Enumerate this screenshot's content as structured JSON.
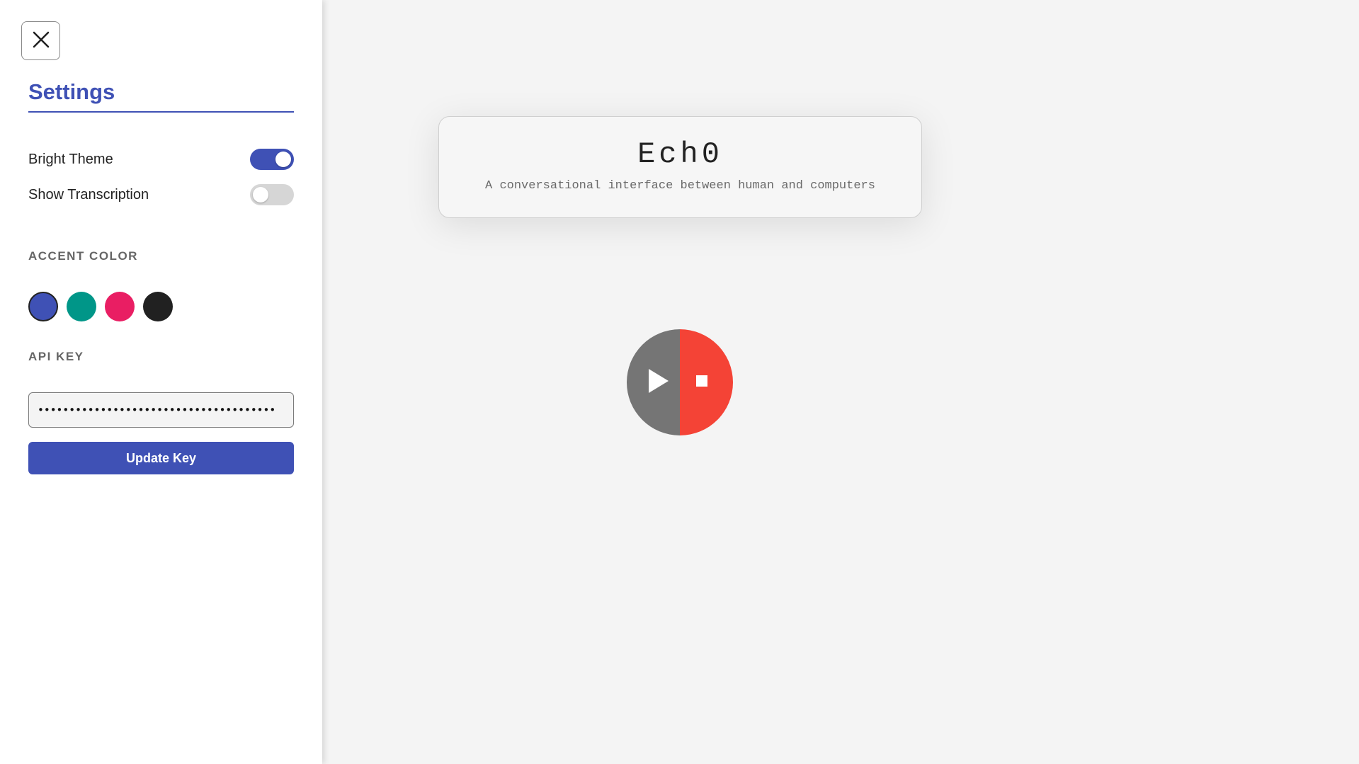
{
  "sidebar": {
    "close_icon": "close-icon",
    "title": "Settings",
    "toggles": [
      {
        "label": "Bright Theme",
        "on": true
      },
      {
        "label": "Show Transcription",
        "on": false
      }
    ],
    "accent_section_label": "ACCENT COLOR",
    "accent_colors": [
      "#3f51b5",
      "#009688",
      "#e91e63",
      "#212121"
    ],
    "selected_accent": "#3f51b5",
    "api_key_label": "API KEY",
    "api_key_value": "••••••••••••••••••••••••••••••••••••••",
    "update_button_label": "Update Key"
  },
  "main": {
    "app_title": "Ech0",
    "app_subtitle": "A conversational interface between human and computers",
    "controls": {
      "play_icon": "play-icon",
      "stop_icon": "stop-icon",
      "play_color": "#757575",
      "stop_color": "#f44336"
    }
  },
  "colors": {
    "accent": "#3f51b5",
    "toggle_off": "#d6d6d6",
    "background": "#f4f4f4"
  }
}
